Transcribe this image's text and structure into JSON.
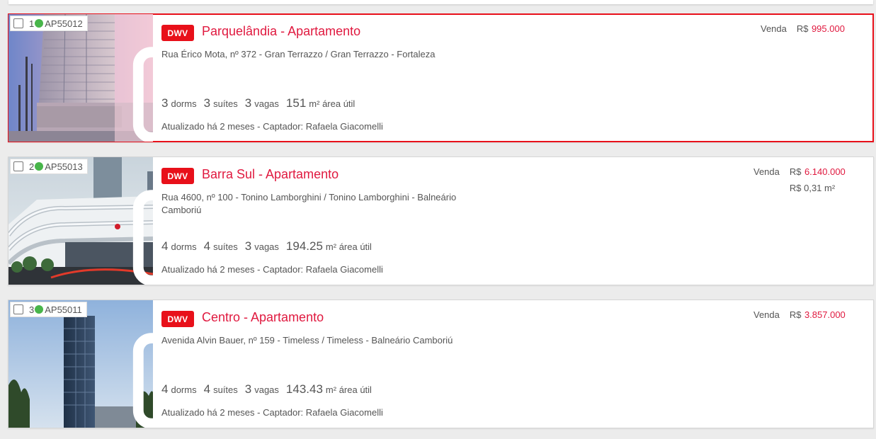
{
  "listings": [
    {
      "index": "1",
      "code": "AP55012",
      "status_color": "#48b54a",
      "badge": "DWV",
      "title": "Parquelândia - Apartamento",
      "address": "Rua Érico Mota, nº 372 - Gran Terrazzo / Gran Terrazzo - Fortaleza",
      "dorms": "3",
      "dorms_label": "dorms",
      "suites": "3",
      "suites_label": "suítes",
      "vagas": "3",
      "vagas_label": "vagas",
      "area": "151",
      "area_label": "m² área útil",
      "updated": "Atualizado há 2 meses - Captador: Rafaela Giacomelli",
      "operation": "Venda",
      "currency": "R$",
      "price": "995.000",
      "price_m2": "",
      "selected": true
    },
    {
      "index": "2",
      "code": "AP55013",
      "status_color": "#48b54a",
      "badge": "DWV",
      "title": "Barra Sul - Apartamento",
      "address": "Rua 4600, nº 100 - Tonino Lamborghini / Tonino Lamborghini - Balneário Camboriú",
      "dorms": "4",
      "dorms_label": "dorms",
      "suites": "4",
      "suites_label": "suítes",
      "vagas": "3",
      "vagas_label": "vagas",
      "area": "194.25",
      "area_label": "m² área útil",
      "updated": "Atualizado há 2 meses - Captador: Rafaela Giacomelli",
      "operation": "Venda",
      "currency": "R$",
      "price": "6.140.000",
      "price_m2": "R$ 0,31 m²",
      "selected": false
    },
    {
      "index": "3",
      "code": "AP55011",
      "status_color": "#48b54a",
      "badge": "DWV",
      "title": "Centro - Apartamento",
      "address": "Avenida Alvin Bauer, nº 159 - Timeless / Timeless - Balneário Camboriú",
      "dorms": "4",
      "dorms_label": "dorms",
      "suites": "4",
      "suites_label": "suítes",
      "vagas": "3",
      "vagas_label": "vagas",
      "area": "143.43",
      "area_label": "m² área útil",
      "updated": "Atualizado há 2 meses - Captador: Rafaela Giacomelli",
      "operation": "Venda",
      "currency": "R$",
      "price": "3.857.000",
      "price_m2": "",
      "selected": false
    }
  ],
  "colors": {
    "accent": "#e8101a",
    "title": "#e0193f",
    "status_green": "#48b54a"
  },
  "icons": {
    "camera": "camera-icon",
    "checkbox": "checkbox-icon"
  }
}
